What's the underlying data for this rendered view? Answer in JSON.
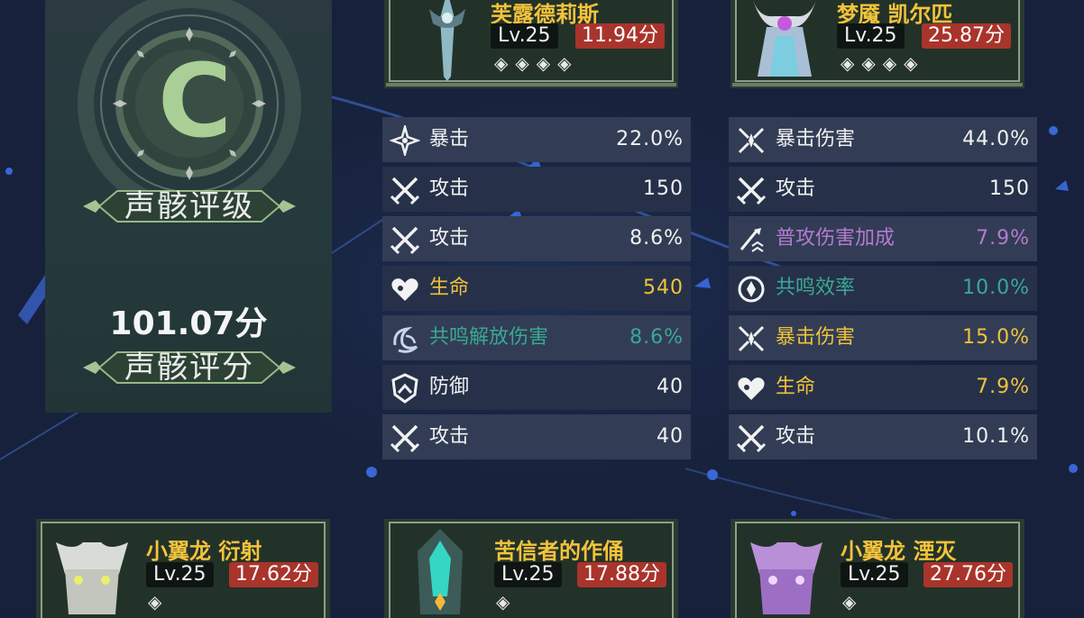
{
  "summary": {
    "grade": "C",
    "grade_label": "声骸评级",
    "total_score": "101.07分",
    "score_label": "声骸评分"
  },
  "echoes": [
    {
      "name": "芙露德莉斯",
      "level": "Lv.25",
      "score": "11.94分",
      "rarity": "◈◈◈◈",
      "icon": "sword-creature-icon"
    },
    {
      "name": "梦魇 凯尔匹",
      "level": "Lv.25",
      "score": "25.87分",
      "rarity": "◈◈◈◈",
      "icon": "horned-beast-icon"
    },
    {
      "name": "小翼龙 衍射",
      "level": "Lv.25",
      "score": "17.62分",
      "rarity": "◈",
      "icon": "white-dragon-icon"
    },
    {
      "name": "苦信者的作俑",
      "level": "Lv.25",
      "score": "17.88分",
      "rarity": "◈",
      "icon": "teal-construct-icon"
    },
    {
      "name": "小翼龙 湮灭",
      "level": "Lv.25",
      "score": "27.76分",
      "rarity": "◈",
      "icon": "purple-dragon-icon"
    }
  ],
  "stats_left": [
    {
      "name": "暴击",
      "value": "22.0%",
      "color": "#f1f1f1",
      "icon": "crit-icon"
    },
    {
      "name": "攻击",
      "value": "150",
      "color": "#f1f1f1",
      "icon": "attack-icon"
    },
    {
      "name": "攻击",
      "value": "8.6%",
      "color": "#f1f1f1",
      "icon": "attack-icon"
    },
    {
      "name": "生命",
      "value": "540",
      "color": "#f1c23a",
      "icon": "hp-icon"
    },
    {
      "name": "共鸣解放伤害",
      "value": "8.6%",
      "color": "#3aa893",
      "icon": "liberation-icon"
    },
    {
      "name": "防御",
      "value": "40",
      "color": "#f1f1f1",
      "icon": "defense-icon"
    },
    {
      "name": "攻击",
      "value": "40",
      "color": "#f1f1f1",
      "icon": "attack-icon"
    }
  ],
  "stats_right": [
    {
      "name": "暴击伤害",
      "value": "44.0%",
      "color": "#f1f1f1",
      "icon": "crit-damage-icon"
    },
    {
      "name": "攻击",
      "value": "150",
      "color": "#f1f1f1",
      "icon": "attack-icon"
    },
    {
      "name": "普攻伤害加成",
      "value": "7.9%",
      "color": "#b47ad0",
      "icon": "basic-attack-icon"
    },
    {
      "name": "共鸣效率",
      "value": "10.0%",
      "color": "#3aa893",
      "icon": "energy-regen-icon"
    },
    {
      "name": "暴击伤害",
      "value": "15.0%",
      "color": "#f1c23a",
      "icon": "crit-damage-icon"
    },
    {
      "name": "生命",
      "value": "7.9%",
      "color": "#f1c23a",
      "icon": "hp-icon"
    },
    {
      "name": "攻击",
      "value": "10.1%",
      "color": "#f1f1f1",
      "icon": "attack-icon"
    }
  ]
}
